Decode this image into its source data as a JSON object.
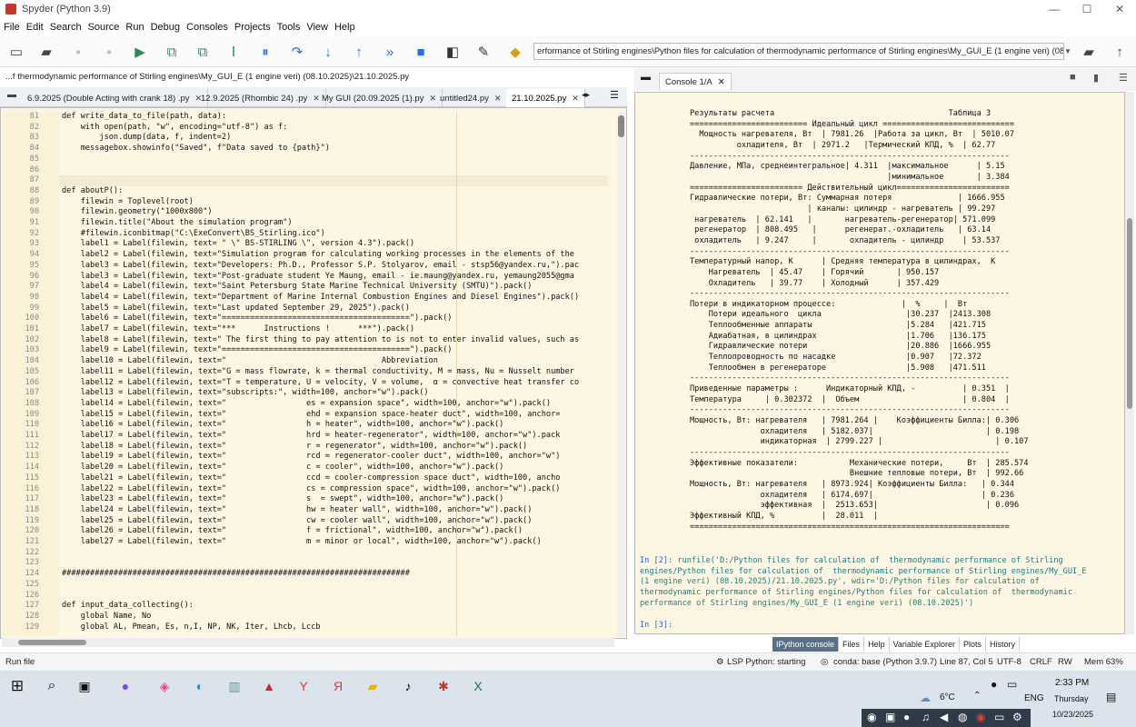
{
  "window": {
    "title": "Spyder (Python 3.9)",
    "controls": [
      "—",
      "☐",
      "✕"
    ]
  },
  "menu": [
    "File",
    "Edit",
    "Search",
    "Source",
    "Run",
    "Debug",
    "Consoles",
    "Projects",
    "Tools",
    "View",
    "Help"
  ],
  "toolbar": {
    "working_dir": "erformance of Stirling engines\\Python files for calculation of  thermodynamic performance of Stirling engines\\My_GUI_E (1 engine veri) (08.10.2025)"
  },
  "editor": {
    "file_path": "...f thermodynamic performance of Stirling engines\\My_GUI_E (1 engine veri) (08.10.2025)\\21.10.2025.py",
    "tabs": [
      {
        "label": "6.9.2025 (Double Acting with crank 18) .py",
        "active": false
      },
      {
        "label": "12.9.2025 (Rhombic 24) .py",
        "active": false
      },
      {
        "label": "My GUI (20.09.2025 (1).py",
        "active": false
      },
      {
        "label": "untitled24.py",
        "active": false
      },
      {
        "label": "21.10.2025.py",
        "active": true
      }
    ],
    "lines": [
      {
        "n": "81",
        "t": "def write_data_to_file(path, data):"
      },
      {
        "n": "82",
        "t": "    with open(path, \"w\", encoding=\"utf-8\") as f:"
      },
      {
        "n": "83",
        "t": "        json.dump(data, f, indent=2)"
      },
      {
        "n": "84",
        "t": "    messagebox.showinfo(\"Saved\", f\"Data saved to {path}\")"
      },
      {
        "n": "85",
        "t": ""
      },
      {
        "n": "86",
        "t": ""
      },
      {
        "n": "87",
        "t": ""
      },
      {
        "n": "88",
        "t": "def aboutP():"
      },
      {
        "n": "89",
        "t": "    filewin = Toplevel(root)"
      },
      {
        "n": "90",
        "t": "    filewin.geometry(\"1000x800\")"
      },
      {
        "n": "91",
        "t": "    filewin.title(\"About the simulation program\")"
      },
      {
        "n": "92",
        "t": "    #filewin.iconbitmap(\"C:\\ExeConvert\\BS_Stirling.ico\")"
      },
      {
        "n": "93",
        "t": "    label1 = Label(filewin, text= \" \\\" BS-STIRLING \\\", version 4.3\").pack()"
      },
      {
        "n": "94",
        "t": "    label2 = Label(filewin, text=\"Simulation program for calculating working processes in the elements of the"
      },
      {
        "n": "95",
        "t": "    label3 = Label(filewin, text=\"Developers: Ph.D., Professor S.P. Stolyarov, email - stsp56@yandex.ru,\").pac"
      },
      {
        "n": "96",
        "t": "    label3 = Label(filewin, text=\"Post-graduate student Ye Maung, email - ie.maung@yandex.ru, yemaung2055@gma"
      },
      {
        "n": "97",
        "t": "    label4 = Label(filewin, text=\"Saint Petersburg State Marine Technical University (SMTU)\").pack()"
      },
      {
        "n": "98",
        "t": "    label4 = Label(filewin, text=\"Department of Marine Internal Combustion Engines and Diesel Engines\").pack()"
      },
      {
        "n": "99",
        "t": "    label5 = Label(filewin, text=\"Last updated September 29, 2025\").pack()"
      },
      {
        "n": "100",
        "t": "    label6 = Label(filewin, text=\"========================================\").pack()"
      },
      {
        "n": "101",
        "t": "    label7 = Label(filewin, text=\"***      Instructions !      ***\").pack()"
      },
      {
        "n": "102",
        "t": "    label8 = Label(filewin, text=\" The first thing to pay attention to is not to enter invalid values, such as"
      },
      {
        "n": "103",
        "t": "    label9 = Label(filewin, text=\"========================================\").pack()"
      },
      {
        "n": "104",
        "t": "    label10 = Label(filewin, text=\"                                 Abbreviation"
      },
      {
        "n": "105",
        "t": "    label11 = Label(filewin, text=\"G = mass flowrate, k = thermal conductivity, M = mass, Nu = Nusselt number"
      },
      {
        "n": "106",
        "t": "    label12 = Label(filewin, text=\"T = temperature, U = velocity, V = volume,  α = convective heat transfer co"
      },
      {
        "n": "107",
        "t": "    label13 = Label(filewin, text=\"subscripts:\", width=100, anchor=\"w\").pack()"
      },
      {
        "n": "108",
        "t": "    label14 = Label(filewin, text=\"                 es = expansion space\", width=100, anchor=\"w\").pack()"
      },
      {
        "n": "109",
        "t": "    label15 = Label(filewin, text=\"                 ehd = expansion space-heater duct\", width=100, anchor="
      },
      {
        "n": "110",
        "t": "    label16 = Label(filewin, text=\"                 h = heater\", width=100, anchor=\"w\").pack()"
      },
      {
        "n": "111",
        "t": "    label17 = Label(filewin, text=\"                 hrd = heater-regenerator\", width=100, anchor=\"w\").pack"
      },
      {
        "n": "112",
        "t": "    label18 = Label(filewin, text=\"                 r = regenerator\", width=100, anchor=\"w\").pack()"
      },
      {
        "n": "113",
        "t": "    label19 = Label(filewin, text=\"                 rcd = regenerator-cooler duct\", width=100, anchor=\"w\")"
      },
      {
        "n": "114",
        "t": "    label20 = Label(filewin, text=\"                 c = cooler\", width=100, anchor=\"w\").pack()"
      },
      {
        "n": "115",
        "t": "    label21 = Label(filewin, text=\"                 ccd = cooler-compression space duct\", width=100, ancho"
      },
      {
        "n": "116",
        "t": "    label22 = Label(filewin, text=\"                 cs = compression space\", width=100, anchor=\"w\").pack()"
      },
      {
        "n": "117",
        "t": "    label23 = Label(filewin, text=\"                 s  = swept\", width=100, anchor=\"w\").pack()"
      },
      {
        "n": "118",
        "t": "    label24 = Label(filewin, text=\"                 hw = heater wall\", width=100, anchor=\"w\").pack()"
      },
      {
        "n": "119",
        "t": "    label25 = Label(filewin, text=\"                 cw = cooler wall\", width=100, anchor=\"w\").pack()"
      },
      {
        "n": "120",
        "t": "    label26 = Label(filewin, text=\"                 f = frictional\", width=100, anchor=\"w\").pack()"
      },
      {
        "n": "121",
        "t": "    label27 = Label(filewin, text=\"                 m = minor or local\", width=100, anchor=\"w\").pack()"
      },
      {
        "n": "122",
        "t": ""
      },
      {
        "n": "123",
        "t": ""
      },
      {
        "n": "124",
        "t": "##########################################################################"
      },
      {
        "n": "125",
        "t": ""
      },
      {
        "n": "126",
        "t": ""
      },
      {
        "n": "127",
        "t": "def input_data_collecting():"
      },
      {
        "n": "128",
        "t": "    global Name, No"
      },
      {
        "n": "129",
        "t": "    global AL, Pmean, Es, n,I, NP, NK, Iter, Lhcb, Lccb"
      }
    ]
  },
  "console": {
    "tab": "Console 1/A",
    "output": "Результаты расчета                                     Таблица 3\n========================= Идеальный цикл ============================\n  Мощность нагревателя, Вт  | 7981.26  |Работа за цикл, Вт  | 5010.07\n          охладителя, Вт  | 2971.2   |Термический КПД, %  | 62.77\n--------------------------------------------------------------------\nДавление, МПа, среднеинтегральное| 4.311  |максимальное      | 5.15\n                                          |минимальное       | 3.384\n======================== Действительный цикл========================\nГидравлические потери, Вт: Суммарная потеря              | 1666.955\n                         | каналы: цилиндр - нагреватель | 99.297\n нагреватель  | 62.141   |       нагреватель-регенератор| 571.099\n регенератор  | 808.495   |      регенерат.-охладитель   | 63.14\n охладитель   | 9.247     |       охладитель - цилиндр    | 53.537\n--------------------------------------------------------------------\nТемпературный напор, К      | Средняя температура в цилиндрах,  К\n    Нагреватель  | 45.47    | Горячий       | 950.157\n    Охладитель   | 39.77    | Холодный      | 357.429\n--------------------------------------------------------------------\nПотери в индикаторном процессе:              |  %     |  Вт\n    Потери идеального  цикла                  |30.237  |2413.308\n    Теплообменные аппараты                    |5.284   |421.715\n    Адиабатная, в цилиндрах                   |1.706   |136.175\n    Гидравлические потери                     |20.886  |1666.955\n    Теплопроводность по насадке               |0.907   |72.372\n    Теплообмен в регенераторе                 |5.908   |471.511\n--------------------------------------------------------------------\nПриведенные параметры :      Индикаторный КПД, -          | 0.351  |\nТемпература     | 0.302372  |  Объем                      | 0.804  |\n--------------------------------------------------------------------\nМощность, Вт: нагревателя   | 7981.264 |    Коэффициенты Билла:| 0.306\n               охладителя   | 5182.037|                        | 0.198\n               индикаторная  | 2799.227 |                        | 0.107\n--------------------------------------------------------------------\nЭффективные показатели:           Механические потери,     Вт  | 285.574\n                                  Внешние тепловые потери, Вт  | 992.66\nМощность, Вт: нагревателя   | 8973.924| Коэффициенты Билла:   | 0.344\n               охладителя   | 6174.697|                       | 0.236\n               эффективная  |  2513.653|                       | 0.096\nЭффективный КПД, %          |  28.011  |\n====================================================================",
    "in2_prompt": "In [2]: ",
    "in2_cmd": "runfile('D:/Python files for calculation of  thermodynamic performance of Stirling\nengines/Python files for calculation of  thermodynamic performance of Stirling engines/My_GUI_E\n(1 engine veri) (08.10.2025)/21.10.2025.py', wdir='D:/Python files for calculation of\nthermodynamic performance of Stirling engines/Python files for calculation of  thermodynamic\nperformance of Stirling engines/My_GUI_E (1 engine veri) (08.10.2025)')",
    "in3_prompt": "In [3]: ",
    "panel_tabs": [
      {
        "label": "IPython console",
        "active": true
      },
      {
        "label": "Files",
        "active": false
      },
      {
        "label": "Help",
        "active": false
      },
      {
        "label": "Variable Explorer",
        "active": false
      },
      {
        "label": "Plots",
        "active": false
      },
      {
        "label": "History",
        "active": false
      }
    ]
  },
  "status": {
    "left": "Run file",
    "lsp": "LSP Python: starting",
    "conda": "conda: base (Python 3.9.7)",
    "pos": "Line 87, Col 5",
    "enc": "UTF-8",
    "eol": "CRLF",
    "rw": "RW",
    "mem": "Mem 63%"
  },
  "taskbar": {
    "weather": "6°C",
    "lang": "ENG",
    "time": "2:33 PM",
    "day": "Thursday",
    "date": "10/23/2025"
  },
  "colors": {
    "editor_bg": "#fdf6e3",
    "console_prompt": "#2266cc",
    "console_text": "#1e7c7c"
  }
}
